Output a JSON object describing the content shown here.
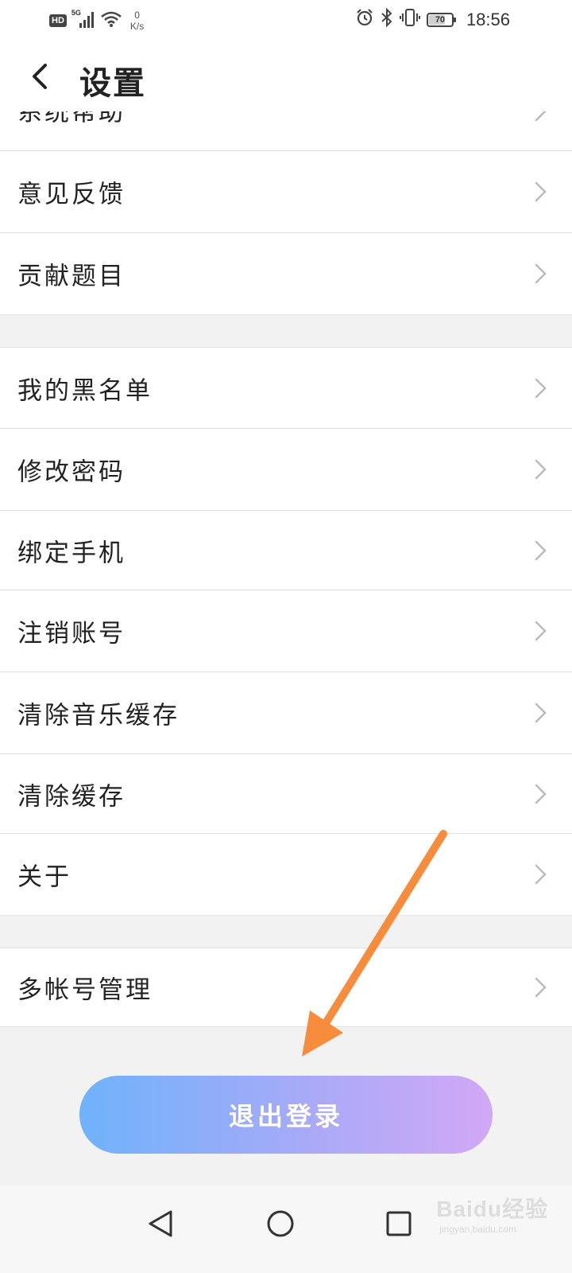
{
  "status_bar": {
    "hd_label": "HD",
    "network_label": "5G",
    "speed_value": "0",
    "speed_unit": "K/s",
    "battery_level": "70",
    "time": "18:56",
    "icons": [
      "signal-icon",
      "wifi-icon",
      "alarm-icon",
      "bluetooth-icon",
      "vibrate-icon",
      "battery-icon"
    ]
  },
  "header": {
    "title": "设置",
    "back_icon": "chevron-left-icon"
  },
  "settings": {
    "partial_item": "系统帮助",
    "group1": [
      {
        "label": "意见反馈"
      },
      {
        "label": "贡献题目"
      }
    ],
    "group2": [
      {
        "label": "我的黑名单"
      },
      {
        "label": "修改密码"
      },
      {
        "label": "绑定手机"
      },
      {
        "label": "注销账号"
      },
      {
        "label": "清除音乐缓存"
      },
      {
        "label": "清除缓存"
      },
      {
        "label": "关于"
      }
    ],
    "group3": [
      {
        "label": "多帐号管理"
      }
    ]
  },
  "logout": {
    "label": "退出登录"
  },
  "annotation": {
    "color": "#f68c3c"
  },
  "nav_bar": {
    "buttons": [
      "back-triangle-icon",
      "home-circle-icon",
      "recents-square-icon"
    ]
  },
  "watermark": {
    "main": "Baidu经验",
    "sub": "jingyan.baidu.com"
  },
  "colors": {
    "gradient_start": "#6fb2fb",
    "gradient_end": "#d1a8f6",
    "background": "#f2f2f2",
    "divider": "#e2e2e2",
    "chevron": "#bbbbbb"
  }
}
